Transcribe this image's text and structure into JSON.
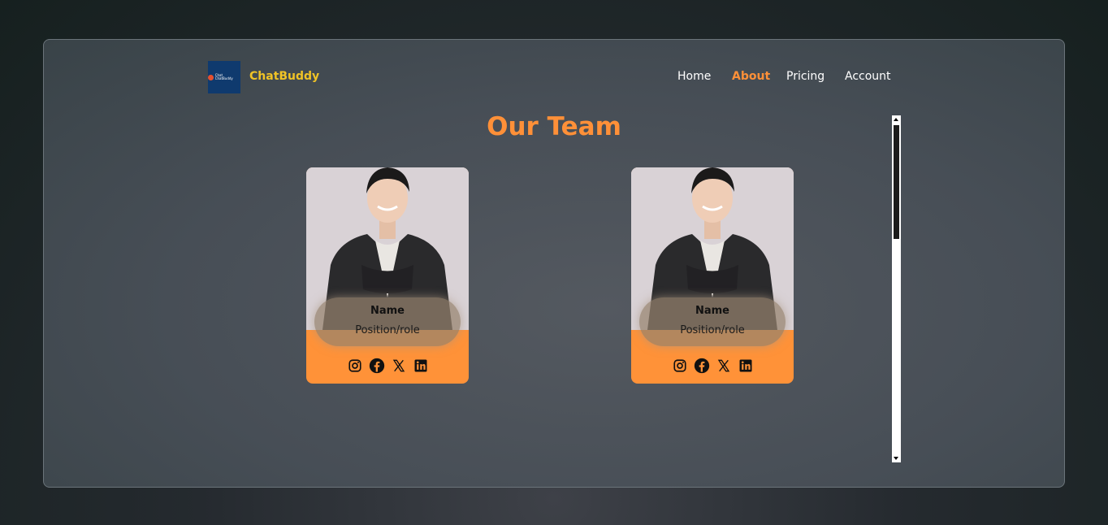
{
  "header": {
    "brand": "ChatBuddy",
    "logo_text": "Chat ChatBuddy",
    "nav": [
      "Home",
      "About",
      "Pricing",
      "Account"
    ],
    "active_nav": "About"
  },
  "main": {
    "title": "Our Team",
    "cards": [
      {
        "name": "Name",
        "role": "Position/role",
        "socials": [
          "instagram-icon",
          "facebook-icon",
          "x-icon",
          "linkedin-icon"
        ]
      },
      {
        "name": "Name",
        "role": "Position/role",
        "socials": [
          "instagram-icon",
          "facebook-icon",
          "x-icon",
          "linkedin-icon"
        ]
      }
    ]
  },
  "colors": {
    "accent": "#ff9038",
    "brand": "#f0c326",
    "card": "#ff9238",
    "logo_bg": "#0f3a6e"
  }
}
